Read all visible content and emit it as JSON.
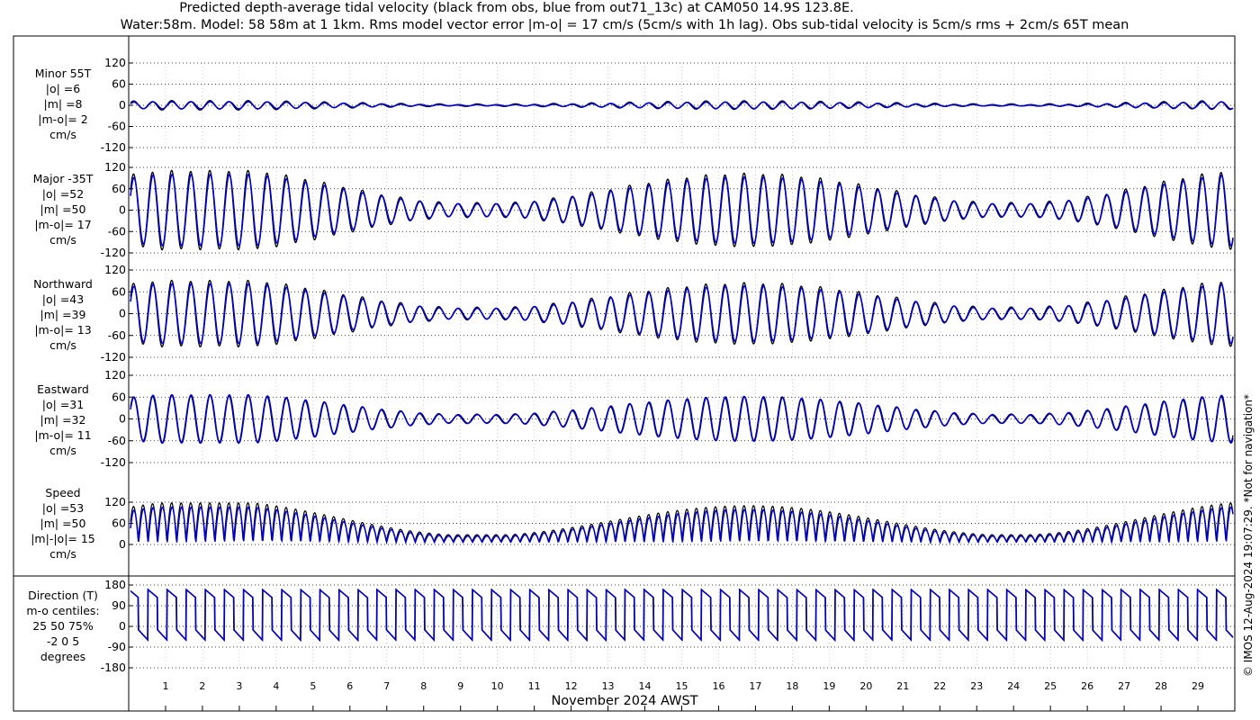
{
  "title_lines": [
    "Predicted depth-average tidal velocity (black from obs, blue from out71_13c) at CAM050 14.9S 123.8E.",
    "Water:58m. Model: 58 58m at 1 1km. Rms model vector error |m-o| = 17 cm/s (5cm/s with 1h lag). Obs sub-tidal velocity is 5cm/s rms + 2cm/s 65T mean"
  ],
  "side_note": "© IMOS 12-Aug-2024 19:07:29. *Not for navigation*",
  "colors": {
    "obs": "#000000",
    "model": "#0000cc",
    "grid": "#000000",
    "axes": "#000000"
  },
  "chart_data": {
    "type": "line",
    "xlabel": "November 2024 AWST",
    "x_range_days": [
      0,
      30
    ],
    "x_tick_labels": [
      "1",
      "2",
      "3",
      "4",
      "5",
      "6",
      "7",
      "8",
      "9",
      "10",
      "11",
      "12",
      "13",
      "14",
      "15",
      "16",
      "17",
      "18",
      "19",
      "20",
      "21",
      "22",
      "23",
      "24",
      "25",
      "26",
      "27",
      "28",
      "29"
    ],
    "grid": true,
    "series_legend": {
      "obs": "black from obs",
      "model": "blue from out71_13c"
    },
    "panels": [
      {
        "id": "minor",
        "label_lines": [
          "Minor 55T",
          "|o| =6",
          "|m| =8",
          "|m-o|= 2",
          "cm/s"
        ],
        "ylim": [
          -120,
          120
        ],
        "yticks": [
          120,
          60,
          0,
          -60,
          -120
        ],
        "ytick_labels": [
          "120",
          "60",
          "0",
          "-60",
          "-120"
        ],
        "kind": "oscillation",
        "amplitude_pattern": "spring-neap",
        "amplitude_obs": 12,
        "amplitude_model": 10
      },
      {
        "id": "major",
        "label_lines": [
          "Major -35T",
          "|o| =52",
          "|m| =50",
          "|m-o|= 17",
          "cm/s"
        ],
        "ylim": [
          -120,
          120
        ],
        "yticks": [
          120,
          60,
          0,
          -60,
          -120
        ],
        "ytick_labels": [
          "120",
          "60",
          "0",
          "-60",
          "-120"
        ],
        "kind": "oscillation",
        "amplitude_pattern": "spring-neap",
        "amplitude_obs": 110,
        "amplitude_model": 100
      },
      {
        "id": "northward",
        "label_lines": [
          "Northward",
          "|o| =43",
          "|m| =39",
          "|m-o|= 13",
          "cm/s"
        ],
        "ylim": [
          -120,
          120
        ],
        "yticks": [
          120,
          60,
          0,
          -60,
          -120
        ],
        "ytick_labels": [
          "120",
          "60",
          "0",
          "-60",
          "-120"
        ],
        "kind": "oscillation",
        "amplitude_pattern": "spring-neap",
        "amplitude_obs": 90,
        "amplitude_model": 82
      },
      {
        "id": "eastward",
        "label_lines": [
          "Eastward",
          "|o| =31",
          "|m| =32",
          "|m-o|= 11",
          "cm/s"
        ],
        "ylim": [
          -120,
          120
        ],
        "yticks": [
          120,
          60,
          0,
          -60,
          -120
        ],
        "ytick_labels": [
          "120",
          "60",
          "0",
          "-60",
          "-120"
        ],
        "kind": "oscillation",
        "amplitude_pattern": "spring-neap",
        "amplitude_obs": 65,
        "amplitude_model": 66
      },
      {
        "id": "speed",
        "label_lines": [
          "Speed",
          "|o| =53",
          "|m| =50",
          "|m|-|o|= 15",
          "cm/s"
        ],
        "ylim": [
          0,
          120
        ],
        "yticks": [
          120,
          60,
          0
        ],
        "ytick_labels": [
          "120",
          "60",
          "0"
        ],
        "kind": "speed",
        "amplitude_pattern": "spring-neap",
        "amplitude_obs": 110,
        "amplitude_model": 100
      },
      {
        "id": "direction",
        "label_lines": [
          "Direction (T)",
          "m-o centiles:",
          "25  50  75%",
          "-2  0  5",
          "degrees"
        ],
        "ylim": [
          -180,
          180
        ],
        "yticks": [
          180,
          90,
          0,
          -90,
          -180
        ],
        "ytick_labels": [
          "180",
          "90",
          "0",
          "-90",
          "-180"
        ],
        "kind": "direction"
      }
    ]
  }
}
